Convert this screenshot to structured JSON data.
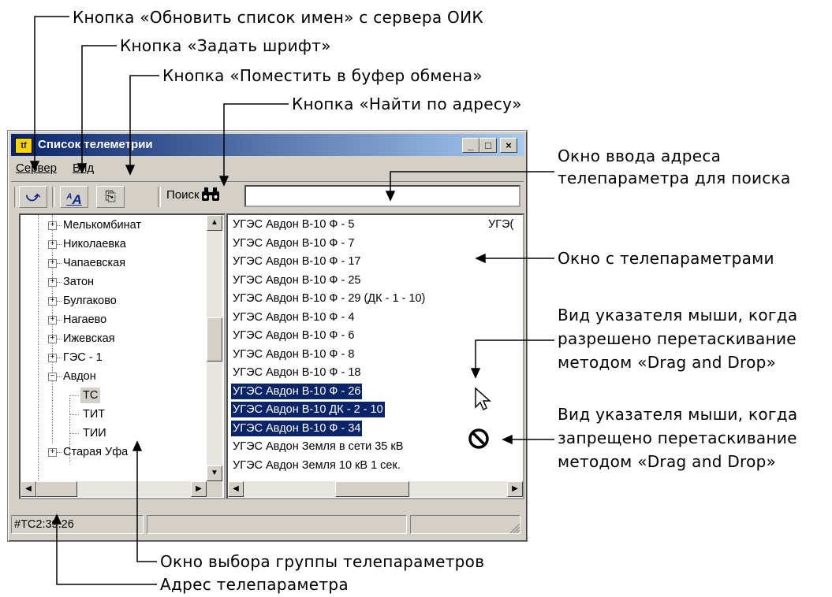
{
  "annotations": {
    "refresh_button": "Кнопка «Обновить список имен» с сервера ОИК",
    "font_button": "Кнопка «Задать шрифт»",
    "copy_button": "Кнопка «Поместить в буфер обмена»",
    "find_button": "Кнопка «Найти по адресу»",
    "input_window_line1": "Окно ввода адреса",
    "input_window_line2": "телепараметра для поиска",
    "params_window": "Окно с телепараметрами",
    "drag_allowed_line1": "Вид указателя мыши, когда",
    "drag_allowed_line2": "разрешено перетаскивание",
    "drag_allowed_line3": "методом «Drag and Drop»",
    "drag_forbidden_line1": "Вид указателя мыши, когда",
    "drag_forbidden_line2": "запрещено перетаскивание",
    "drag_forbidden_line3": "методом «Drag and Drop»",
    "group_window": "Окно выбора группы телепараметров",
    "param_address": "Адрес телепараметра"
  },
  "window": {
    "title": "Список телеметрии",
    "app_icon": "telemetry-app-icon",
    "minimize": "_",
    "maximize": "□",
    "close": "×"
  },
  "menu": {
    "server": "Сервер",
    "view": "Вид"
  },
  "toolbar": {
    "refresh_icon": "refresh-icon",
    "font_icon": "font-icon",
    "copy_icon": "clipboard-icon",
    "search_label": "Поиск",
    "binoculars_icon": "binoculars-icon",
    "search_value": ""
  },
  "tree": {
    "items": [
      {
        "label": "Мелькомбинат",
        "expanded": false
      },
      {
        "label": "Николаевка",
        "expanded": false
      },
      {
        "label": "Чапаевская",
        "expanded": false
      },
      {
        "label": "Затон",
        "expanded": false
      },
      {
        "label": "Булгаково",
        "expanded": false
      },
      {
        "label": "Нагаево",
        "expanded": false
      },
      {
        "label": "Ижевская",
        "expanded": false
      },
      {
        "label": "ГЭС - 1",
        "expanded": false
      },
      {
        "label": "Авдон",
        "expanded": true
      },
      {
        "label": "ТС",
        "child": true,
        "selected": true
      },
      {
        "label": "ТИТ",
        "child": true
      },
      {
        "label": "ТИИ",
        "child": true
      },
      {
        "label": "Старая Уфа",
        "expanded": false
      }
    ]
  },
  "list": {
    "rows": [
      {
        "label": "УГЭС Авдон В-10 Ф - 5",
        "selected": false
      },
      {
        "label": "УГЭС Авдон В-10 Ф - 7",
        "selected": false
      },
      {
        "label": "УГЭС Авдон В-10 Ф - 17",
        "selected": false
      },
      {
        "label": "УГЭС Авдон В-10 Ф - 25",
        "selected": false
      },
      {
        "label": "УГЭС Авдон В-10 Ф - 29 (ДК - 1 - 10)",
        "selected": false
      },
      {
        "label": "УГЭС Авдон В-10 Ф - 4",
        "selected": false
      },
      {
        "label": "УГЭС Авдон В-10 Ф - 6",
        "selected": false
      },
      {
        "label": "УГЭС Авдон В-10 Ф - 8",
        "selected": false
      },
      {
        "label": "УГЭС Авдон В-10 Ф - 18",
        "selected": false
      },
      {
        "label": "УГЭС Авдон В-10 Ф - 26",
        "selected": true
      },
      {
        "label": "УГЭС Авдон В-10 ДК - 2 - 10",
        "selected": true
      },
      {
        "label": "УГЭС Авдон В-10 Ф - 34",
        "selected": true
      },
      {
        "label": "УГЭС Авдон Земля в сети 35 кВ",
        "selected": false
      },
      {
        "label": "УГЭС Авдон Земля 10 кВ 1 сек.",
        "selected": false
      }
    ],
    "second_column_fragment": "УГЭ("
  },
  "cursors": {
    "allowed": "arrow-cursor-icon",
    "forbidden": "no-drop-cursor-icon"
  },
  "status": {
    "address": "#TC2:39:26",
    "cell2": "",
    "cell3": ""
  }
}
